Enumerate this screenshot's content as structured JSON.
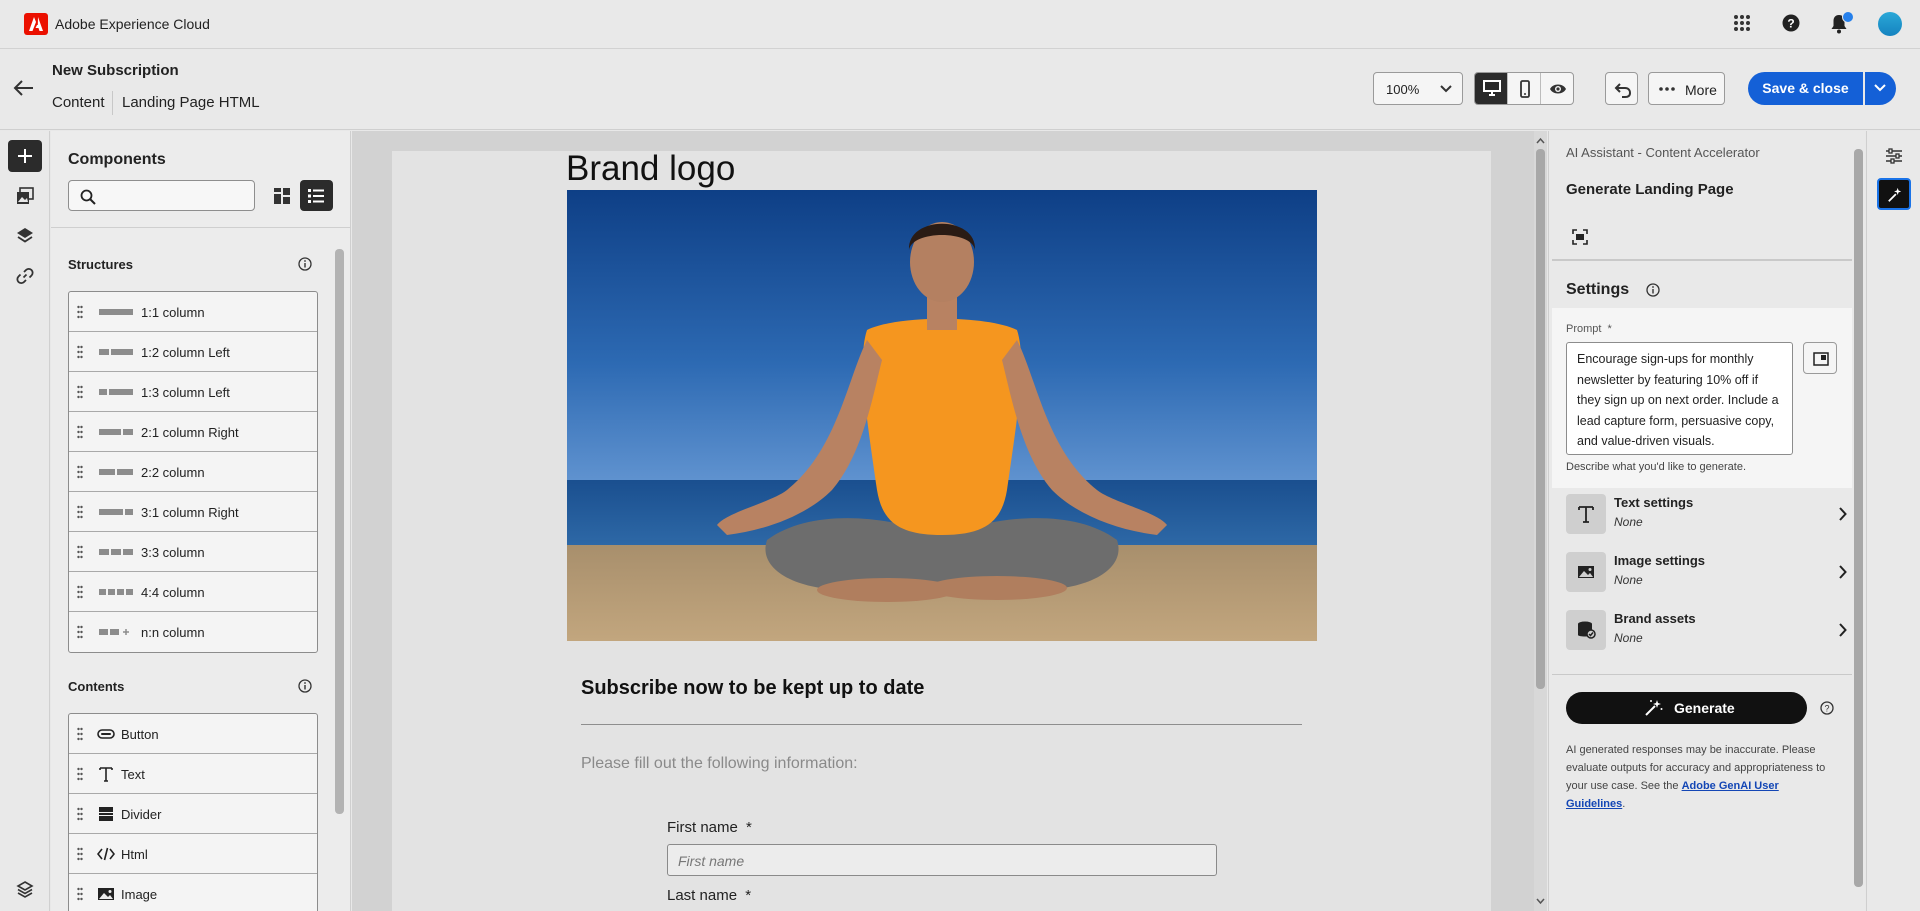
{
  "app": {
    "name": "Adobe Experience Cloud"
  },
  "header": {
    "title": "New Subscription",
    "breadcrumb_content": "Content",
    "breadcrumb_page": "Landing Page HTML",
    "zoom": "100%",
    "more_label": "More",
    "save_label": "Save & close"
  },
  "components": {
    "title": "Components",
    "search_placeholder": "",
    "structures_label": "Structures",
    "structures": [
      {
        "label": "1:1 column",
        "icon": "structure-1-1-icon"
      },
      {
        "label": "1:2 column Left",
        "icon": "structure-1-2-icon"
      },
      {
        "label": "1:3 column Left",
        "icon": "structure-1-3-icon"
      },
      {
        "label": "2:1 column Right",
        "icon": "structure-2-1-icon"
      },
      {
        "label": "2:2 column",
        "icon": "structure-2-2-icon"
      },
      {
        "label": "3:1 column Right",
        "icon": "structure-3-1-icon"
      },
      {
        "label": "3:3 column",
        "icon": "structure-3-3-icon"
      },
      {
        "label": "4:4 column",
        "icon": "structure-4-4-icon"
      },
      {
        "label": "n:n column",
        "icon": "structure-n-n-icon"
      }
    ],
    "contents_label": "Contents",
    "contents": [
      {
        "label": "Button",
        "icon": "button-icon"
      },
      {
        "label": "Text",
        "icon": "text-icon"
      },
      {
        "label": "Divider",
        "icon": "divider-icon"
      },
      {
        "label": "Html",
        "icon": "html-icon"
      },
      {
        "label": "Image",
        "icon": "image-icon"
      }
    ]
  },
  "canvas": {
    "brand_logo": "Brand logo",
    "subscribe_heading": "Subscribe now to be kept up to date",
    "form_intro": "Please fill out the following information:",
    "fields": [
      {
        "label": "First name",
        "required": "*",
        "placeholder": "First name"
      },
      {
        "label": "Last name",
        "required": "*",
        "placeholder": ""
      }
    ]
  },
  "ai_panel": {
    "subtitle": "AI Assistant - Content Accelerator",
    "title": "Generate Landing Page",
    "settings_label": "Settings",
    "prompt_label": "Prompt",
    "prompt_required": "*",
    "prompt_text": "Encourage sign-ups for monthly newsletter by featuring 10% off if they sign up on next order. Include a lead capture form, persuasive copy, and value-driven visuals.",
    "prompt_help": "Describe what you'd like to generate.",
    "settings": [
      {
        "name": "Text settings",
        "value": "None",
        "icon": "text-icon"
      },
      {
        "name": "Image settings",
        "value": "None",
        "icon": "image-icon"
      },
      {
        "name": "Brand assets",
        "value": "None",
        "icon": "brand-assets-icon"
      }
    ],
    "generate_label": "Generate",
    "disclaimer_text": "AI generated responses may be inaccurate. Please evaluate outputs for accuracy and appropriateness to your use case. See the ",
    "disclaimer_link": "Adobe GenAI User Guidelines",
    "disclaimer_end": "."
  },
  "colors": {
    "accent": "#1460d7",
    "adobe_red": "#eb1000",
    "dark": "#2b2b2b"
  }
}
